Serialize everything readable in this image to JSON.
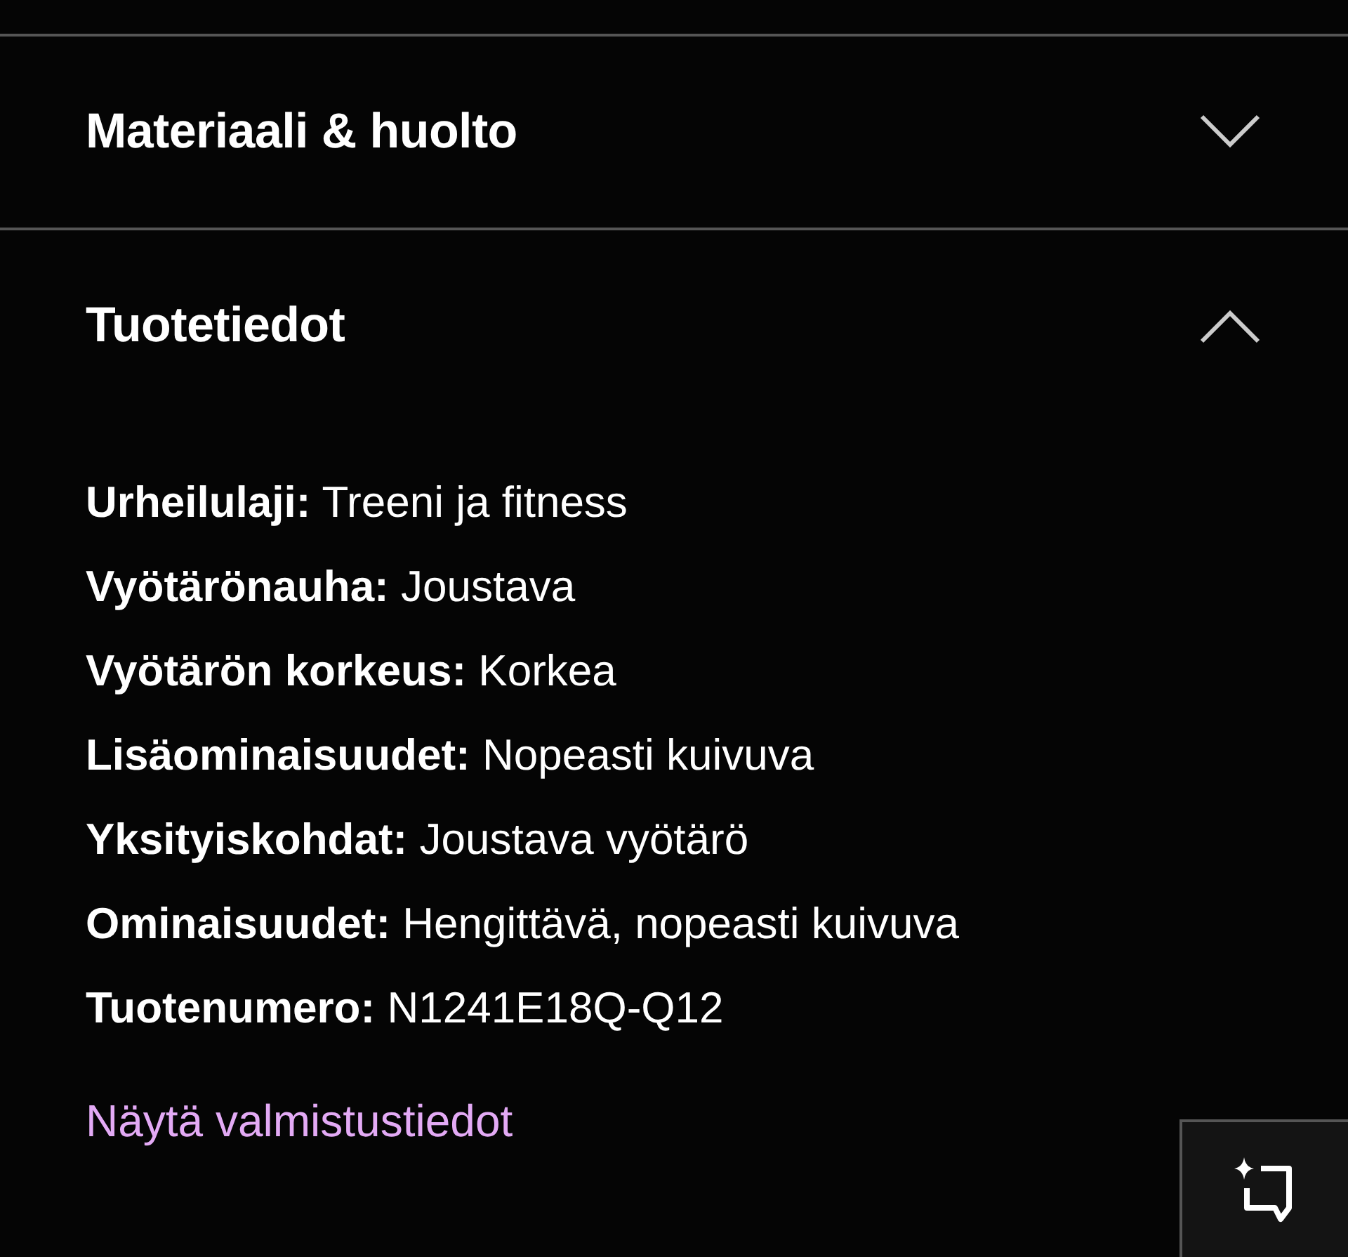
{
  "sections": [
    {
      "title": "Materiaali & huolto",
      "expanded": false
    },
    {
      "title": "Tuotetiedot",
      "expanded": true,
      "details": [
        {
          "label": "Urheilulaji:",
          "value": "Treeni ja fitness"
        },
        {
          "label": "Vyötärönauha:",
          "value": "Joustava"
        },
        {
          "label": "Vyötärön korkeus:",
          "value": "Korkea"
        },
        {
          "label": "Lisäominaisuudet:",
          "value": "Nopeasti kuivuva"
        },
        {
          "label": "Yksityiskohdat:",
          "value": "Joustava vyötärö"
        },
        {
          "label": "Ominaisuudet:",
          "value": "Hengittävä, nopeasti kuivuva"
        },
        {
          "label": "Tuotenumero:",
          "value": "N1241E18Q-Q12"
        }
      ],
      "link": "Näytä valmistustiedot"
    }
  ]
}
